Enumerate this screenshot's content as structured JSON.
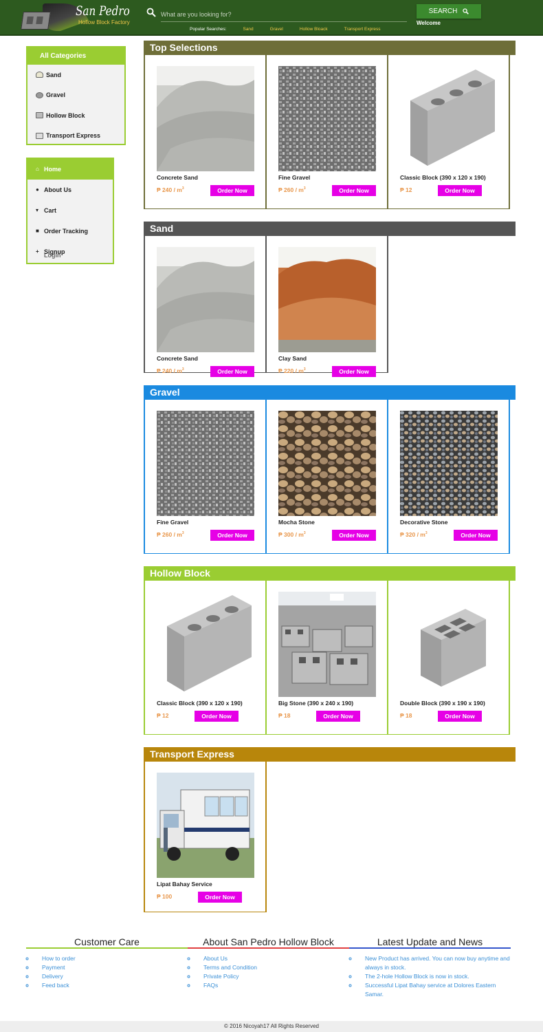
{
  "header": {
    "logo_title": "San Pedro",
    "logo_subtitle": "Hollow Block Factory",
    "search_placeholder": "What are you looking for?",
    "search_button": "SEARCH",
    "welcome": "Welcome",
    "popular_label": "Popular Searches:",
    "popular_links": [
      "Sand",
      "Gravel",
      "Hollow Bloack",
      "Transport Express"
    ]
  },
  "categories": {
    "title": "All Categories",
    "items": [
      "Sand",
      "Gravel",
      "Hollow Block",
      "Transport Express"
    ]
  },
  "menu": {
    "items": [
      "Home",
      "About Us",
      "Cart",
      "Order Tracking",
      "Signup"
    ],
    "overlap_text": "Login"
  },
  "currency": "₱",
  "order_label": "Order Now",
  "sections": {
    "top": {
      "title": "Top Selections",
      "color": "#6e6e38",
      "products": [
        {
          "name": "Concrete Sand",
          "price": "₱ 240 / m",
          "unit_exp": "3",
          "image": "sand-pile"
        },
        {
          "name": "Fine Gravel",
          "price": "₱ 260 / m",
          "unit_exp": "3",
          "image": "fine-gravel"
        },
        {
          "name": "Classic Block (390 x 120 x 190)",
          "price": "₱ 12",
          "unit_exp": "",
          "image": "classic-block"
        }
      ]
    },
    "sand": {
      "title": "Sand",
      "color": "#555555",
      "products": [
        {
          "name": "Concrete Sand",
          "price": "₱ 240 / m",
          "unit_exp": "3",
          "image": "sand-pile"
        },
        {
          "name": "Clay Sand",
          "price": "₱ 220 / m",
          "unit_exp": "3",
          "image": "clay-sand"
        }
      ]
    },
    "gravel": {
      "title": "Gravel",
      "color": "#1a8ae0",
      "products": [
        {
          "name": "Fine Gravel",
          "price": "₱ 260 / m",
          "unit_exp": "3",
          "image": "fine-gravel"
        },
        {
          "name": "Mocha Stone",
          "price": "₱ 300 / m",
          "unit_exp": "3",
          "image": "mocha-stone"
        },
        {
          "name": "Decorative Stone",
          "price": "₱ 320 / m",
          "unit_exp": "3",
          "image": "decorative-stone"
        }
      ]
    },
    "hollow": {
      "title": "Hollow Block",
      "color": "#9acd32",
      "products": [
        {
          "name": "Classic Block (390 x 120 x 190)",
          "price": "₱ 12",
          "unit_exp": "",
          "image": "classic-block"
        },
        {
          "name": "Big Stone (390 x 240 x 190)",
          "price": "₱ 18",
          "unit_exp": "",
          "image": "block-stacks"
        },
        {
          "name": "Double Block (390 x 190 x 190)",
          "price": "₱ 18",
          "unit_exp": "",
          "image": "double-block"
        }
      ]
    },
    "transport": {
      "title": "Transport Express",
      "color": "#b8860b",
      "products": [
        {
          "name": "Lipat Bahay Service",
          "price": "₱ 100",
          "unit_exp": "",
          "image": "truck"
        }
      ]
    }
  },
  "footer": {
    "care": {
      "title": "Customer Care",
      "color": "#9acd32",
      "links": [
        "How to order",
        "Payment",
        "Delivery",
        "Feed back"
      ]
    },
    "about": {
      "title": "About San Pedro Hollow Block",
      "color": "#e04040",
      "links": [
        "About Us",
        "Terms and Condition",
        "Private Policy",
        "FAQs"
      ]
    },
    "news": {
      "title": "Latest Update and News",
      "color": "#3355cc",
      "links": [
        "New Product has arrived. You can now buy anytime and always in stock.",
        "The 2-hole Hollow Block is now in stock.",
        "Successful Lipat Bahay service at Dolores Eastern Samar."
      ]
    },
    "copyright": "© 2016 Nicoyah17 All Rights Reserved"
  }
}
